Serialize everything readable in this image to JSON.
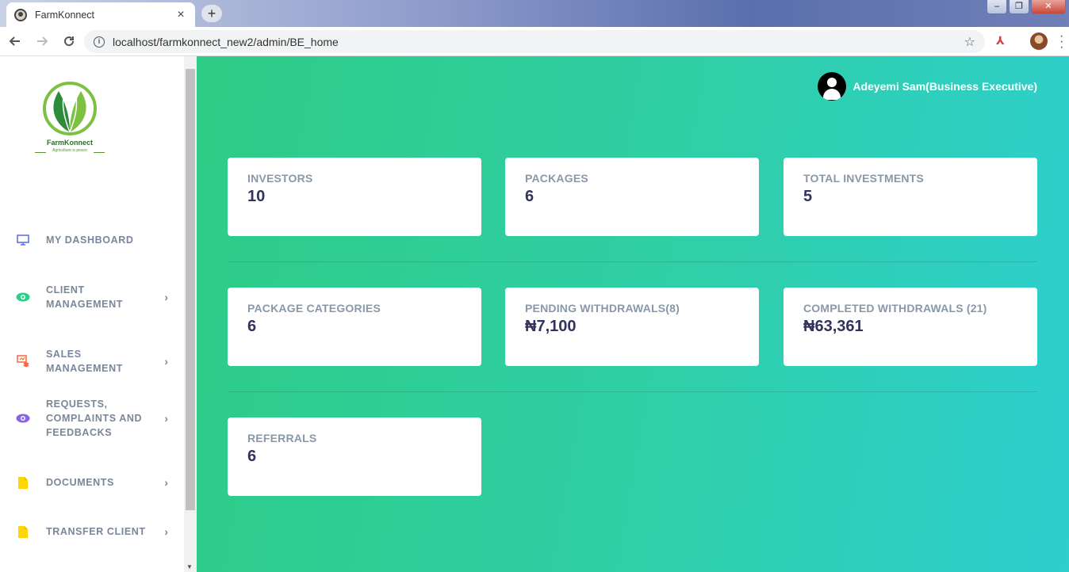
{
  "browser": {
    "tab_title": "FarmKonnect",
    "tab_close": "×",
    "new_tab": "+",
    "url": "localhost/farmkonnect_new2/admin/BE_home",
    "window_controls": [
      "–",
      "❐",
      "✕"
    ]
  },
  "brand": {
    "name": "FarmKonnect",
    "tagline": "Agriculture is peace"
  },
  "user": {
    "name": "Adeyemi Sam(Business Executive)"
  },
  "sidebar": {
    "items": [
      {
        "label": "MY DASHBOARD",
        "icon": "monitor-icon",
        "color": "#5e72e4",
        "has_chevron": false
      },
      {
        "label": "CLIENT MANAGEMENT",
        "icon": "eye-icon",
        "color": "#2dce89",
        "has_chevron": true
      },
      {
        "label": "SALES MANAGEMENT",
        "icon": "sales-icon",
        "color": "#fb6340",
        "has_chevron": true
      },
      {
        "label": "REQUESTS, COMPLAINTS AND FEEDBACKS",
        "icon": "eye-icon",
        "color": "#8965e0",
        "has_chevron": true
      },
      {
        "label": "DOCUMENTS",
        "icon": "document-icon",
        "color": "#ffd600",
        "has_chevron": true
      },
      {
        "label": "TRANSFER CLIENT",
        "icon": "document-icon",
        "color": "#ffd600",
        "has_chevron": true
      }
    ],
    "chevron": "›"
  },
  "stats": [
    {
      "label": "INVESTORS",
      "value": "10"
    },
    {
      "label": "PACKAGES",
      "value": "6"
    },
    {
      "label": "TOTAL INVESTMENTS",
      "value": "5"
    },
    {
      "label": "PACKAGE CATEGORIES",
      "value": "6"
    },
    {
      "label": "PENDING WITHDRAWALS(8)",
      "value": "₦7,100"
    },
    {
      "label": "COMPLETED WITHDRAWALS (21)",
      "value": "₦63,361"
    },
    {
      "label": "REFERRALS",
      "value": "6"
    }
  ],
  "colors": {
    "accent_gradient_start": "#2ecc85",
    "accent_gradient_end": "#2dcfcf",
    "card_label": "#8898aa",
    "card_value": "#32325d"
  }
}
